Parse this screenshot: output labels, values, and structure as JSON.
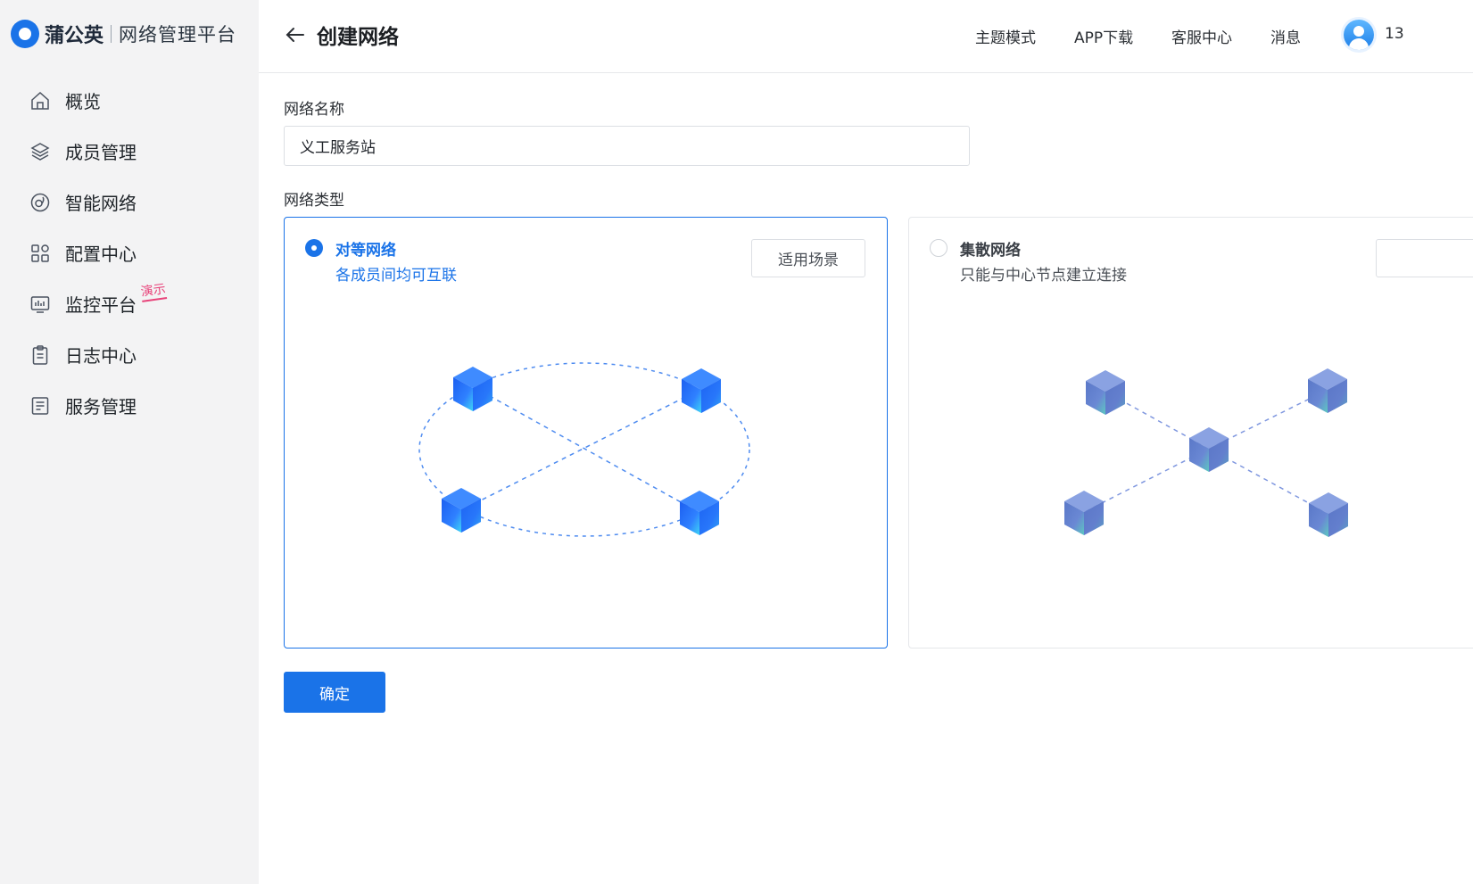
{
  "brand": {
    "name": "蒲公英",
    "subtitle": "网络管理平台"
  },
  "sidebar": {
    "items": [
      {
        "label": "概览",
        "icon": "home-icon"
      },
      {
        "label": "成员管理",
        "icon": "layers-icon"
      },
      {
        "label": "智能网络",
        "icon": "network-icon"
      },
      {
        "label": "配置中心",
        "icon": "grid-icon"
      },
      {
        "label": "监控平台",
        "icon": "monitor-icon",
        "badge": "演示"
      },
      {
        "label": "日志中心",
        "icon": "clipboard-icon"
      },
      {
        "label": "服务管理",
        "icon": "document-icon"
      }
    ]
  },
  "header": {
    "title": "创建网络",
    "links": [
      "主题模式",
      "APP下载",
      "客服中心",
      "消息"
    ],
    "user": "13"
  },
  "form": {
    "name_label": "网络名称",
    "name_value": "义工服务站",
    "type_label": "网络类型",
    "types": [
      {
        "title": "对等网络",
        "desc": "各成员间均可互联",
        "button": "适用场景",
        "selected": true
      },
      {
        "title": "集散网络",
        "desc": "只能与中心节点建立连接",
        "button": "",
        "selected": false
      }
    ],
    "confirm": "确定"
  },
  "colors": {
    "accent": "#1a73e8",
    "badge": "#e8437a",
    "sidebar_bg": "#f3f3f4"
  }
}
